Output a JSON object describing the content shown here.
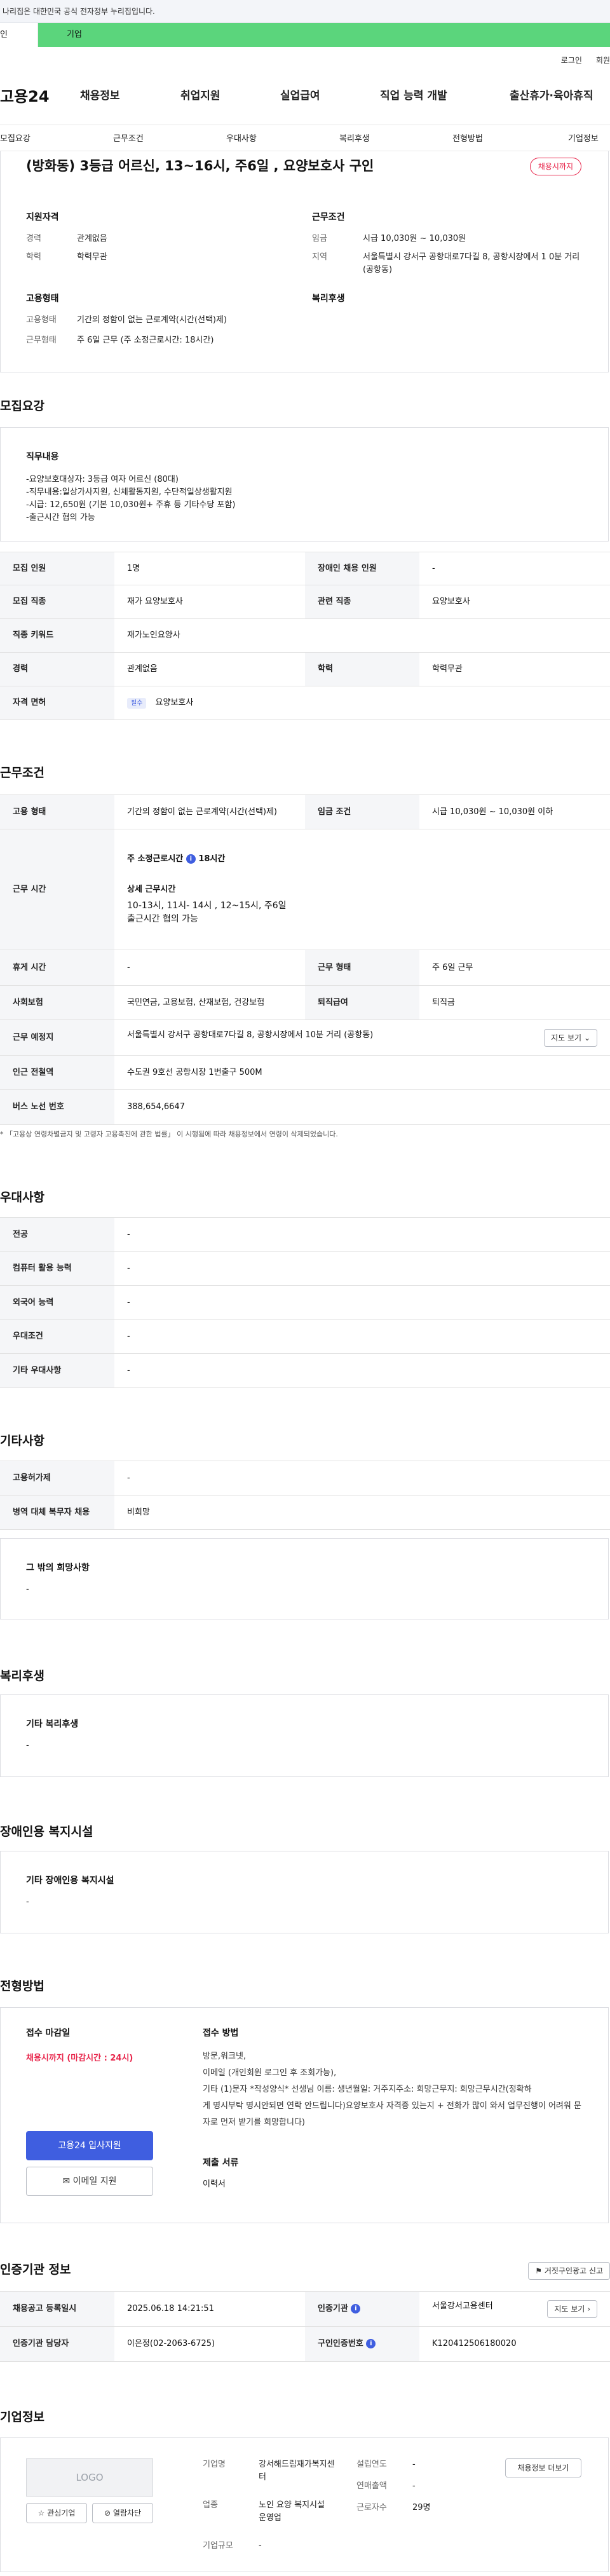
{
  "banner": {
    "text": "나리집은 대한민국 공식 전자정부 누리집입니다."
  },
  "tabs": {
    "personal": "인",
    "company": "기업"
  },
  "util": {
    "login": "로그인",
    "join": "회원"
  },
  "gnb": {
    "logo": "고용24",
    "items": [
      "채용정보",
      "취업지원",
      "실업급여",
      "직업 능력 개발",
      "출산휴가·육아휴직"
    ]
  },
  "subnav": [
    "모집요강",
    "근무조건",
    "우대사항",
    "복리후생",
    "전형방법",
    "기업정보"
  ],
  "job": {
    "title": "(방화동) 3등급 어르신, 13~16시, 주6일 , 요양보호사 구인",
    "status_badge": "채용시까지",
    "qual_heading": "지원자격",
    "qual": [
      {
        "label": "경력",
        "value": "관계없음"
      },
      {
        "label": "학력",
        "value": "학력무관"
      }
    ],
    "cond_heading": "근무조건",
    "cond": [
      {
        "label": "임금",
        "value": "시급 10,030원 ~ 10,030원"
      },
      {
        "label": "지역",
        "value": "서울특별시 강서구 공항대로7다길 8, 공항시장에서 1 0분 거리 (공항동)"
      }
    ],
    "emp_heading": "고용형태",
    "emp": [
      {
        "label": "고용형태",
        "value": "기간의 정함이 없는 근로계약(시간(선택)제)"
      },
      {
        "label": "근무형태",
        "value": "주 6일 근무 (주 소정근로시간: 18시간)"
      }
    ],
    "welfare_heading": "복리후생"
  },
  "recruit": {
    "heading": "모집요강",
    "duty_label": "직무내용",
    "duty_lines": [
      "-요양보호대상자: 3등급 여자 어르신 (80대)",
      "-직무내용:일상가사지원, 신체활동지원, 수단적일상생활지원",
      "-시급: 12,650원 (기본 10,030원+ 주휴 등 기타수당 포함)",
      "-출근시간 협의 가능"
    ],
    "rows": [
      [
        "모집 인원",
        "1명",
        "장애인 채용 인원",
        "-"
      ],
      [
        "모집 직종",
        "재가 요양보호사",
        "관련 직종",
        "요양보호사"
      ],
      [
        "직종 키워드",
        "재가노인요양사",
        "",
        ""
      ],
      [
        "경력",
        "관계없음",
        "학력",
        "학력무관"
      ]
    ],
    "license_label": "자격 면허",
    "license_badge": "필수",
    "license_value": "요양보호사"
  },
  "workcond": {
    "heading": "근무조건",
    "emp_label": "고용 형태",
    "emp_value": "기간의 정함이 없는 근로계약(시간(선택)제)",
    "wage_label": "임금 조건",
    "wage_value": "시급 10,030원 ~ 10,030원 이하",
    "time_label": "근무 시간",
    "weekly_label": "주 소정근로시간",
    "weekly_value": "18시간",
    "detail_label": "상세 근무시간",
    "detail_line1": "10-13시, 11시- 14시 , 12~15시,  주6일",
    "detail_line2": "출근시간 협의 가능",
    "holiday_label": "휴게 시간",
    "holiday_value": "-",
    "shift_label": "근무 형태",
    "shift_value": "주 6일 근무",
    "insurance_label": "사회보험",
    "insurance_value": "국민연금, 고용보험, 산재보험, 건강보험",
    "severance_label": "퇴직급여",
    "severance_value": "퇴직금",
    "place_label": "근무 예정지",
    "place_value": "서울특별시 강서구 공항대로7다길 8, 공항시장에서 10분 거리 (공항동)",
    "map_button": "지도 보기",
    "subway_label": "인근 전철역",
    "subway_value": "수도권 9호선 공항시장 1번출구 500M",
    "bus_label": "버스 노선 번호",
    "bus_value": "388,654,6647",
    "note": "「고용상 연령차별금지 및 고령자 고용촉진에 관한 법률」 이 시행됨에 따라 채용정보에서 연령이 삭제되었습니다."
  },
  "preference": {
    "heading": "우대사항",
    "rows": [
      [
        "전공",
        "-"
      ],
      [
        "컴퓨터 활용 능력",
        "-"
      ],
      [
        "외국어 능력",
        "-"
      ],
      [
        "우대조건",
        "-"
      ],
      [
        "기타 우대사항",
        "-"
      ]
    ]
  },
  "etc": {
    "heading": "기타사항",
    "rows": [
      [
        "고용허가제",
        "-"
      ],
      [
        "병역 대체 복무자 채용",
        "비희망"
      ]
    ],
    "other_label": "그 밖의 희망사항",
    "other_value": "-"
  },
  "welfare": {
    "heading": "복리후생",
    "label": "기타 복리후생",
    "value": "-"
  },
  "disability": {
    "heading": "장애인용 복지시설",
    "label": "기타 장애인용 복지시설",
    "value": "-"
  },
  "screening": {
    "heading": "전형방법",
    "deadline_label": "접수 마감일",
    "deadline_value": "채용시까지 (마감시간 : 24시)",
    "apply_button": "고용24 입사지원",
    "email_button": "이메일 지원",
    "method_label": "접수 방법",
    "method_lines": [
      "방문,워크넷,",
      "이메일 (개인회원 로그인 후 조회가능),",
      "기타 (1)문자 *작성양식* 선생님 이름: 생년월일: 거주지주소: 희망근무지: 희망근무시간(정확하",
      "게 명시부탁 명시안되면 연락 안드립니다)요양보호사 자격증 있는지 + 전화가 많이 와서 업무진행이 어려워 문",
      "자로 먼저 받기를 희망합니다)"
    ],
    "docs_label": "제출 서류",
    "docs_value": "이력서"
  },
  "agency": {
    "heading": "인증기관 정보",
    "report_button": "거짓구인광고 신고",
    "reg_label": "채용공고 등록일시",
    "reg_value": "2025.06.18 14:21:51",
    "org_label": "인증기관",
    "org_value": "서울강서고용센터",
    "map_button": "지도 보기",
    "manager_label": "인증기관 담당자",
    "manager_value": "이은정(02-2063-6725)",
    "cert_label": "구인인증번호",
    "cert_value": "K120412506180020"
  },
  "company": {
    "heading": "기업정보",
    "logo_text": "LOGO",
    "fav_button": "관심기업",
    "block_button": "열람차단",
    "name_label": "기업명",
    "name_value": "강서해드림재가복지센터",
    "industry_label": "업종",
    "industry_value": "노인 요양 복지시설 운영업",
    "size_label": "기업규모",
    "size_value": "-",
    "founded_label": "설립연도",
    "founded_value": "-",
    "revenue_label": "연매출액",
    "revenue_value": "-",
    "employees_label": "근로자수",
    "employees_value": "29명",
    "hiring_button": "채용정보 더보기"
  }
}
